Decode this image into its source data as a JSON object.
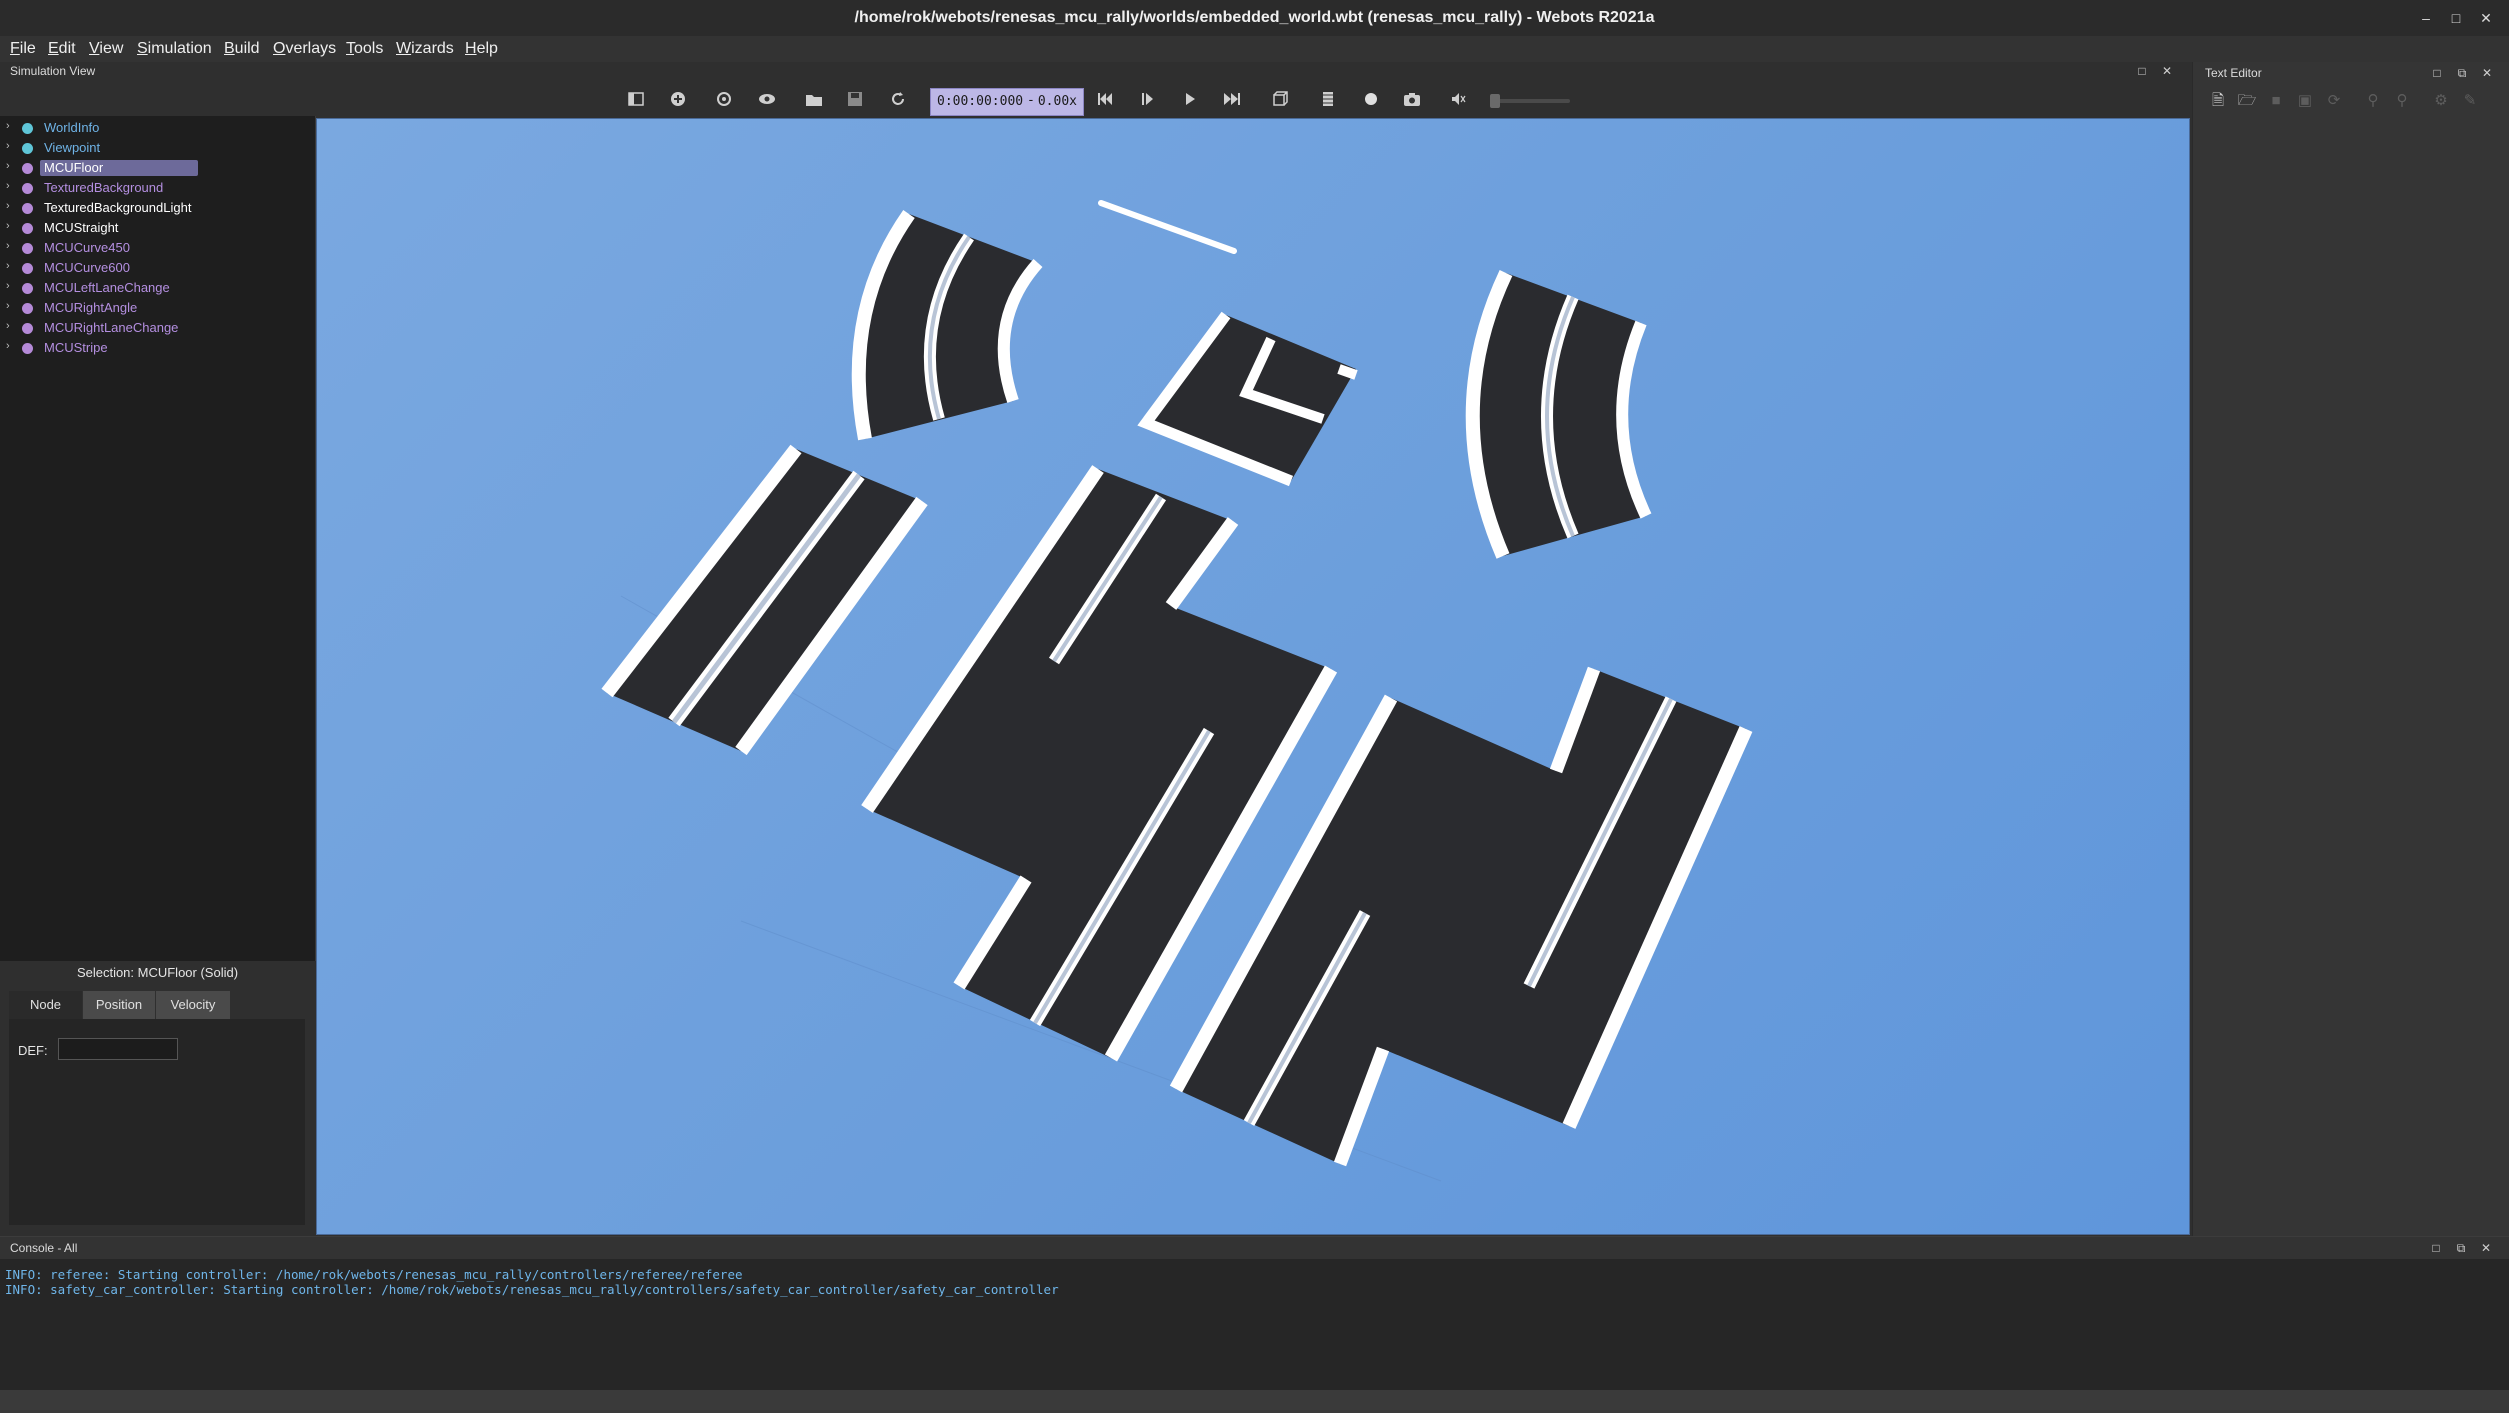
{
  "window": {
    "title": "/home/rok/webots/renesas_mcu_rally/worlds/embedded_world.wbt (renesas_mcu_rally) - Webots R2021a",
    "controls": [
      "minimize-icon",
      "maximize-icon",
      "close-icon"
    ]
  },
  "menu": {
    "items": [
      {
        "mnemonic": "F",
        "rest": "ile"
      },
      {
        "mnemonic": "E",
        "rest": "dit"
      },
      {
        "mnemonic": "V",
        "rest": "iew"
      },
      {
        "mnemonic": "S",
        "rest": "imulation"
      },
      {
        "mnemonic": "B",
        "rest": "uild"
      },
      {
        "mnemonic": "O",
        "rest": "verlays"
      },
      {
        "mnemonic": "T",
        "rest": "ools"
      },
      {
        "mnemonic": "W",
        "rest": "izards"
      },
      {
        "mnemonic": "H",
        "rest": "elp"
      }
    ]
  },
  "simulation_view": {
    "label": "Simulation View"
  },
  "toolbar": {
    "time": "0:00:00:000",
    "separator": "-",
    "speed": "0.00x",
    "buttons": [
      "toggle-scene-tree-icon",
      "add-node-icon",
      "reload-node-icon",
      "view-icon",
      "open-world-icon",
      "save-world-icon",
      "reload-world-icon",
      "reset-icon",
      "step-icon",
      "run-icon",
      "fast-icon",
      "rendering-icon",
      "record-movie-icon",
      "record-animation-icon",
      "screenshot-icon",
      "mute-icon"
    ]
  },
  "scene_tree": {
    "items": [
      {
        "label": "WorldInfo",
        "color": "#5fc6d8",
        "selected": false,
        "text_color": "#6fb3e6"
      },
      {
        "label": "Viewpoint",
        "color": "#5fc6d8",
        "selected": false,
        "text_color": "#6fb3e6"
      },
      {
        "label": "MCUFloor",
        "color": "#b58ad8",
        "selected": true,
        "text_color": "#ffffff"
      },
      {
        "label": "TexturedBackground",
        "color": "#b58ad8",
        "selected": false,
        "text_color": "#b48fe0"
      },
      {
        "label": "TexturedBackgroundLight",
        "color": "#b58ad8",
        "selected": false,
        "text_color": "#ffffff"
      },
      {
        "label": "MCUStraight",
        "color": "#b58ad8",
        "selected": false,
        "text_color": "#ffffff"
      },
      {
        "label": "MCUCurve450",
        "color": "#b58ad8",
        "selected": false,
        "text_color": "#b48fe0"
      },
      {
        "label": "MCUCurve600",
        "color": "#b58ad8",
        "selected": false,
        "text_color": "#b48fe0"
      },
      {
        "label": "MCULeftLaneChange",
        "color": "#b58ad8",
        "selected": false,
        "text_color": "#b48fe0"
      },
      {
        "label": "MCURightAngle",
        "color": "#b58ad8",
        "selected": false,
        "text_color": "#b48fe0"
      },
      {
        "label": "MCURightLaneChange",
        "color": "#b58ad8",
        "selected": false,
        "text_color": "#b48fe0"
      },
      {
        "label": "MCUStripe",
        "color": "#b58ad8",
        "selected": false,
        "text_color": "#b48fe0"
      }
    ]
  },
  "field_editor": {
    "selection": "Selection: MCUFloor (Solid)",
    "tabs": [
      "Node",
      "Position",
      "Velocity"
    ],
    "active_tab": "Node",
    "def_label": "DEF:",
    "def_value": ""
  },
  "text_editor": {
    "label": "Text Editor",
    "icons": [
      {
        "name": "new-file-icon",
        "enabled": true
      },
      {
        "name": "open-file-icon",
        "enabled": true
      },
      {
        "name": "save-file-icon",
        "enabled": false
      },
      {
        "name": "save-all-icon",
        "enabled": false
      },
      {
        "name": "revert-icon",
        "enabled": false
      },
      {
        "name": "find-icon",
        "enabled": false
      },
      {
        "name": "replace-icon",
        "enabled": false
      },
      {
        "name": "build-icon",
        "enabled": false
      },
      {
        "name": "clean-icon",
        "enabled": false
      }
    ]
  },
  "console": {
    "label": "Console - All",
    "lines": [
      "INFO: referee: Starting controller: /home/rok/webots/renesas_mcu_rally/controllers/referee/referee",
      "INFO: safety_car_controller: Starting controller: /home/rok/webots/renesas_mcu_rally/controllers/safety_car_controller/safety_car_controller"
    ]
  },
  "colors": {
    "viewport_sky": "#6b9edc",
    "track_asphalt": "#2a2b2f",
    "track_line": "#ffffff",
    "selection": "#6d6a9a",
    "time_box": "#bcb7e6"
  }
}
